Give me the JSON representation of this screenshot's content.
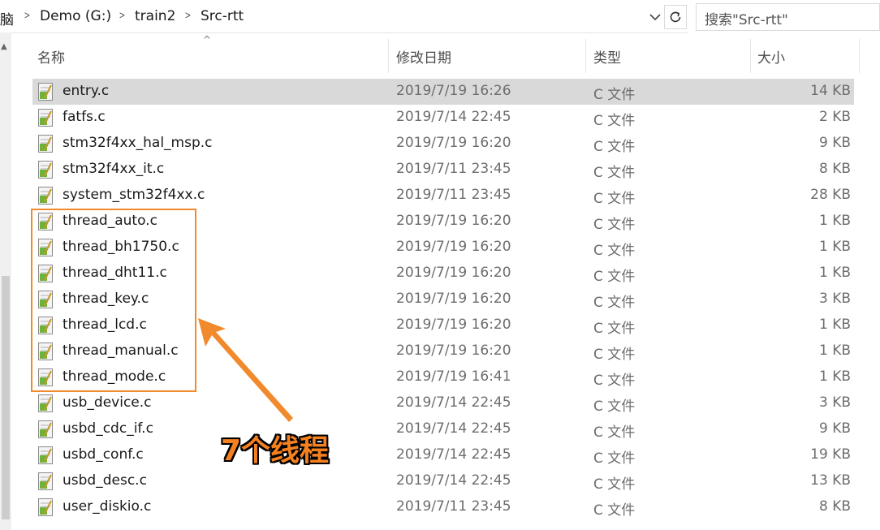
{
  "address_bar": {
    "crumbs": [
      "脑",
      "Demo (G:)",
      "train2",
      "Src-rtt"
    ],
    "separator": ">",
    "dropdown_icon": "chevron-down-icon",
    "refresh_icon": "refresh-icon"
  },
  "search": {
    "placeholder": "搜索\"Src-rtt\""
  },
  "columns": {
    "name": "名称",
    "date_modified": "修改日期",
    "type": "类型",
    "size": "大小"
  },
  "files": [
    {
      "name": "entry.c",
      "date": "2019/7/19 16:26",
      "type": "C 文件",
      "size": "14 KB",
      "selected": true
    },
    {
      "name": "fatfs.c",
      "date": "2019/7/14 22:45",
      "type": "C 文件",
      "size": "2 KB"
    },
    {
      "name": "stm32f4xx_hal_msp.c",
      "date": "2019/7/19 16:20",
      "type": "C 文件",
      "size": "9 KB"
    },
    {
      "name": "stm32f4xx_it.c",
      "date": "2019/7/11 23:45",
      "type": "C 文件",
      "size": "8 KB"
    },
    {
      "name": "system_stm32f4xx.c",
      "date": "2019/7/11 23:45",
      "type": "C 文件",
      "size": "28 KB"
    },
    {
      "name": "thread_auto.c",
      "date": "2019/7/19 16:20",
      "type": "C 文件",
      "size": "1 KB"
    },
    {
      "name": "thread_bh1750.c",
      "date": "2019/7/19 16:20",
      "type": "C 文件",
      "size": "1 KB"
    },
    {
      "name": "thread_dht11.c",
      "date": "2019/7/19 16:20",
      "type": "C 文件",
      "size": "1 KB"
    },
    {
      "name": "thread_key.c",
      "date": "2019/7/19 16:20",
      "type": "C 文件",
      "size": "3 KB"
    },
    {
      "name": "thread_lcd.c",
      "date": "2019/7/19 16:20",
      "type": "C 文件",
      "size": "1 KB"
    },
    {
      "name": "thread_manual.c",
      "date": "2019/7/19 16:20",
      "type": "C 文件",
      "size": "1 KB"
    },
    {
      "name": "thread_mode.c",
      "date": "2019/7/19 16:41",
      "type": "C 文件",
      "size": "1 KB"
    },
    {
      "name": "usb_device.c",
      "date": "2019/7/14 22:45",
      "type": "C 文件",
      "size": "3 KB"
    },
    {
      "name": "usbd_cdc_if.c",
      "date": "2019/7/14 22:45",
      "type": "C 文件",
      "size": "9 KB"
    },
    {
      "name": "usbd_conf.c",
      "date": "2019/7/14 22:45",
      "type": "C 文件",
      "size": "19 KB"
    },
    {
      "name": "usbd_desc.c",
      "date": "2019/7/14 22:45",
      "type": "C 文件",
      "size": "13 KB"
    },
    {
      "name": "user_diskio.c",
      "date": "2019/7/11 23:45",
      "type": "C 文件",
      "size": "8 KB"
    }
  ],
  "annotation": {
    "label": "7个线程",
    "color": "#f08a2c"
  },
  "colors": {
    "selected_row": "#d9d9d9",
    "secondary_text": "#6d6d6d"
  }
}
